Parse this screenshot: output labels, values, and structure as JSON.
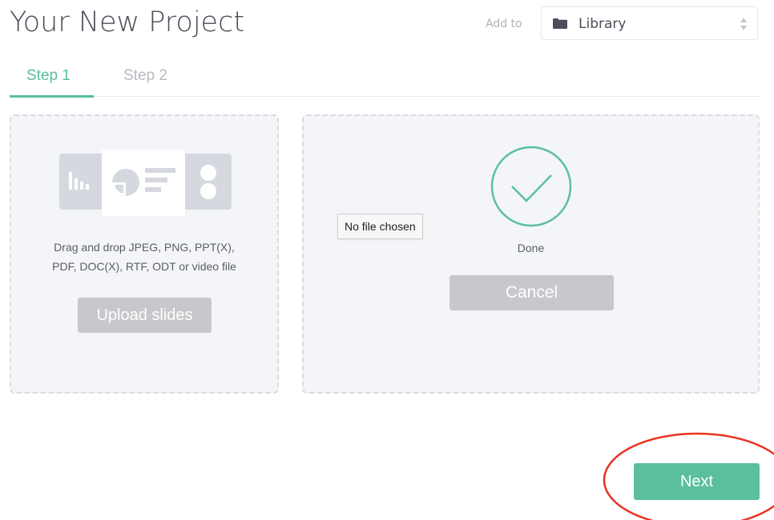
{
  "header": {
    "title": "Your New Project",
    "add_to_label": "Add to",
    "destination_select": {
      "selected": "Library",
      "icon": "folder-icon"
    }
  },
  "tabs": [
    {
      "label": "Step 1",
      "active": true
    },
    {
      "label": "Step 2",
      "active": false
    }
  ],
  "upload_panel": {
    "instructions_line1": "Drag and drop JPEG, PNG, PPT(X),",
    "instructions_line2": "PDF, DOC(X), RTF, ODT or video file",
    "upload_button": "Upload slides"
  },
  "status_panel": {
    "file_input_tooltip": "No file chosen",
    "status_text": "Done",
    "cancel_button": "Cancel",
    "icon": "check-circle-icon"
  },
  "footer": {
    "next_button": "Next"
  },
  "colors": {
    "accent": "#5bbf9d",
    "annotation": "#e8321f",
    "button_disabled": "#c6c8cb",
    "panel_bg": "#f4f5f8"
  }
}
